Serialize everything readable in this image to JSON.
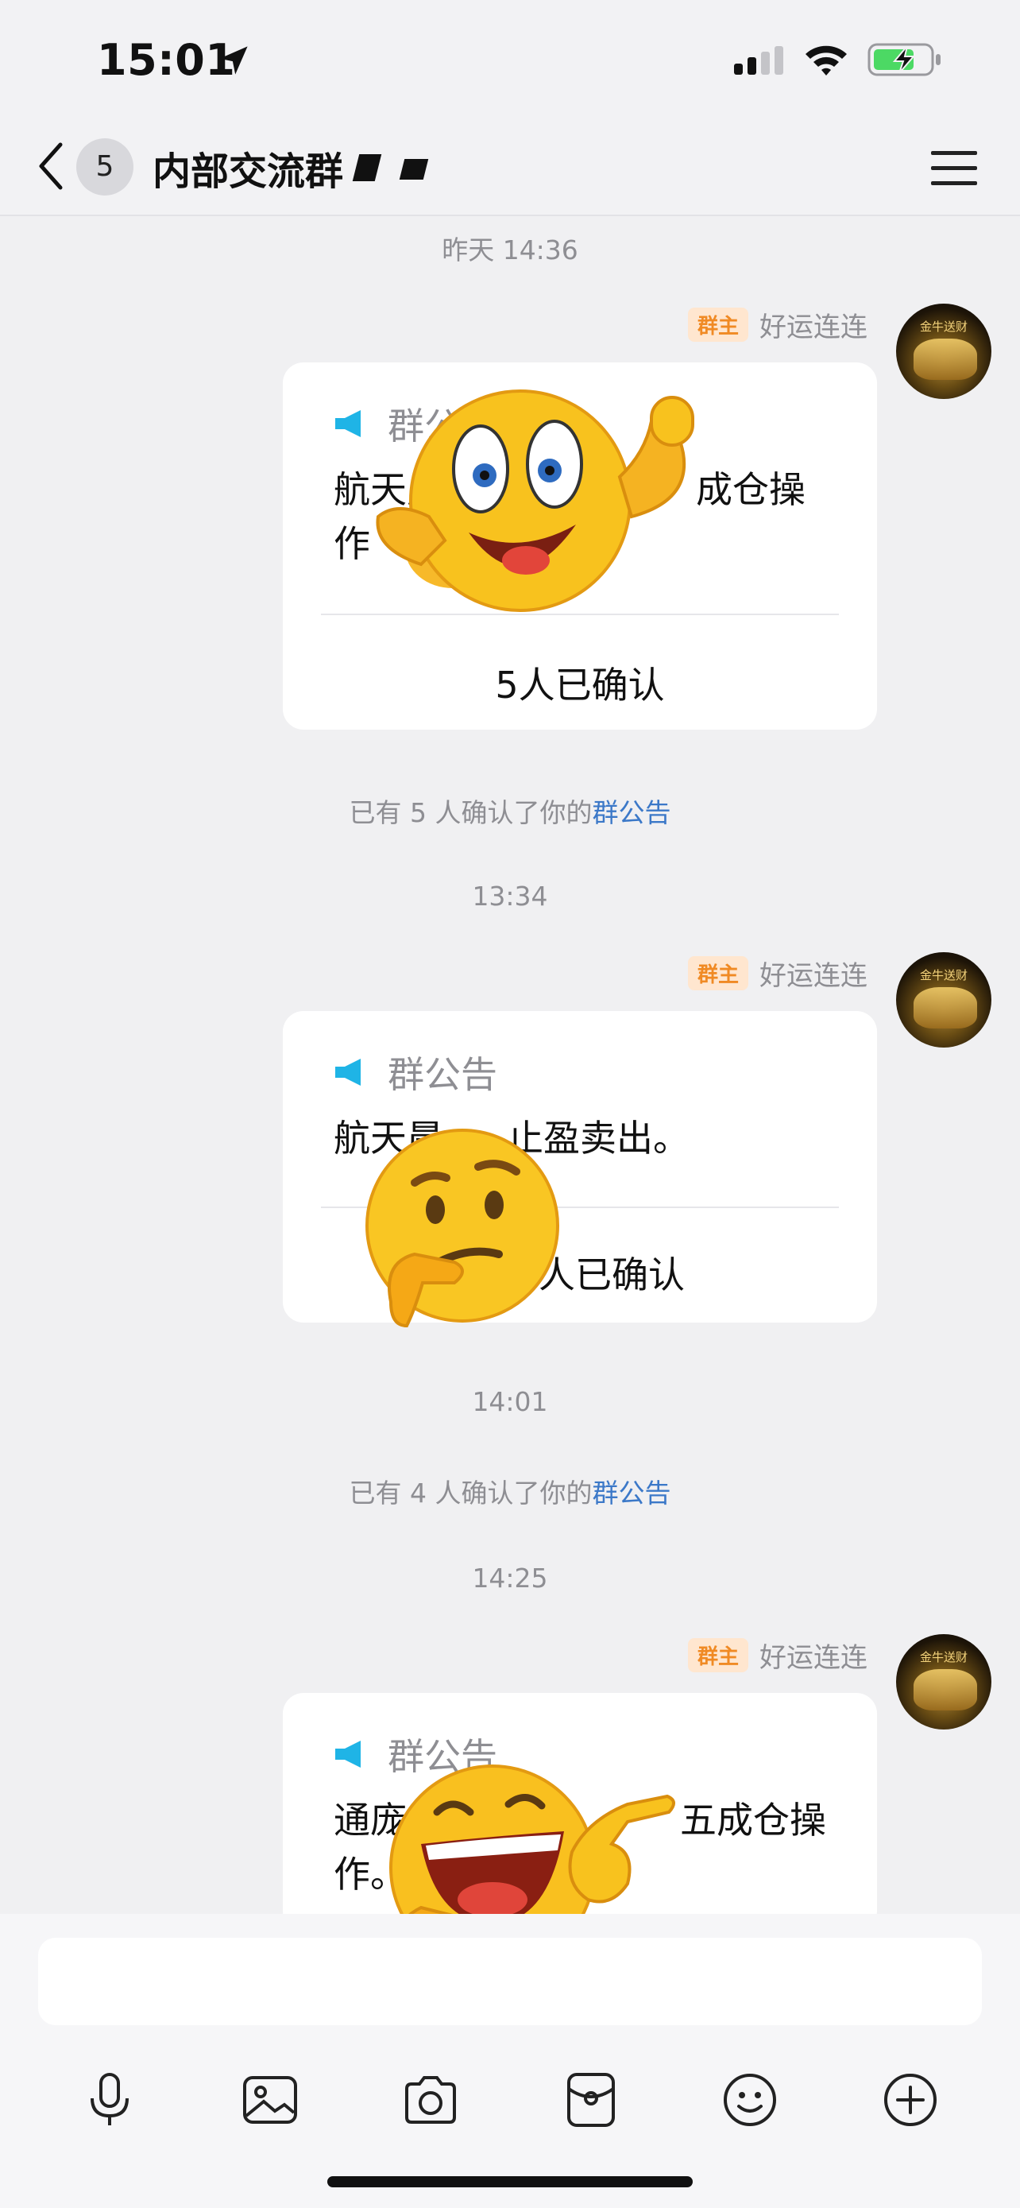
{
  "status_bar": {
    "time": "15:01",
    "icons": [
      "location-arrow-icon",
      "cellular-signal-icon",
      "wifi-icon",
      "battery-charging-icon"
    ]
  },
  "header": {
    "unread_count": "5",
    "title": "内部交流群",
    "icons": [
      "back-chevron-icon",
      "menu-icon"
    ]
  },
  "chat": {
    "timestamps": [
      "昨天 14:36",
      "13:34",
      "14:01",
      "14:25"
    ],
    "sender": {
      "role": "群主",
      "name": "好运连连",
      "avatar_text": "金牛送财"
    },
    "announcement_label": "群公告",
    "messages": [
      {
        "body_line1_a": "航天晨",
        "body_line1_b": "成仓操",
        "body_line2": "作",
        "confirm": "5人已确认"
      },
      {
        "body_a": "航天晨",
        "body_b": "止盈卖出。",
        "confirm": "人已确认"
      },
      {
        "body_line1_a": "通庞",
        "body_line1_b": "五成仓操",
        "body_line2": "作。"
      }
    ],
    "system_messages": [
      {
        "prefix": "已有 5 人确认了你的",
        "link": "群公告"
      },
      {
        "prefix": "已有 4 人确认了你的",
        "link": "群公告"
      }
    ],
    "stickers": [
      "thumbs-up-smiley-sticker",
      "thinking-face-sticker",
      "laughing-pointing-sticker"
    ]
  },
  "input_bar": {
    "tools": [
      "microphone-icon",
      "image-icon",
      "camera-icon",
      "red-packet-icon",
      "emoji-icon",
      "plus-icon"
    ]
  },
  "colors": {
    "background": "#f0f0f2",
    "link": "#3b78c8",
    "role_tag_bg": "#ffe6cf",
    "role_tag_text": "#f08a24",
    "speaker": "#1fb4e6"
  }
}
